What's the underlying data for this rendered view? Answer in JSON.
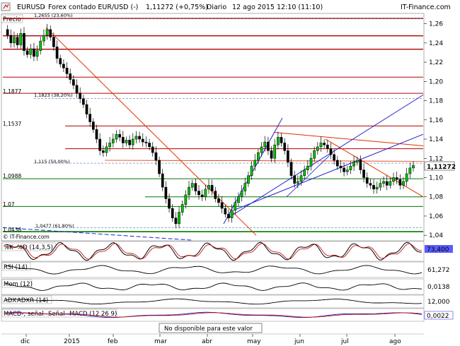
{
  "header": {
    "symbol": "EURUSD",
    "instrument": "Forex contado EUR/USD (-)",
    "last_change": "1,11272 (+0,75%)",
    "timeframe": "Diario",
    "datetime": "12 ago 2015 12:10 (11:10)",
    "source": "IT-Finance.com"
  },
  "main_panel": {
    "label": "Precio",
    "current_price_label": "1,11272",
    "levels_left": [
      "1,1877",
      "1,1537",
      "1,0988",
      "1,07",
      "1,0438"
    ],
    "fib_labels": [
      "1,2655 (23,60%)",
      "1,1823 (38,20%)",
      "1,115 (50,00%)",
      "1,0477 (61,80%)"
    ],
    "watermark": "© IT-Finance.com"
  },
  "indicators": {
    "stoch": {
      "name": "%K",
      "label": "%D (14,3,5)",
      "value": "73,400",
      "value_bg": "#5b5bff"
    },
    "rsi": {
      "label": "RSI (14)",
      "value": "61,272"
    },
    "mom": {
      "label": "Mom (12)",
      "value": "0,0138"
    },
    "adx": {
      "name": "ADX",
      "label": "ADXR (14)",
      "value": "12,000"
    },
    "macd": {
      "name": "MACD-, señal",
      "signal": "Señal",
      "label": "MACD (12 26 9)",
      "value": "0,0022"
    }
  },
  "status_message": "No disponible para este valor",
  "chart_data": {
    "type": "candlestick",
    "title": "EURUSD - Forex contado EUR/USD (-)",
    "x_ticks": [
      "dic",
      "2015",
      "feb",
      "mar",
      "abr",
      "may",
      "jun",
      "jul",
      "ago"
    ],
    "y_ticks": [
      1.26,
      1.24,
      1.22,
      1.2,
      1.18,
      1.16,
      1.14,
      1.12,
      1.1,
      1.08,
      1.06,
      1.04
    ],
    "ylim": [
      1.035,
      1.27
    ],
    "last_price": 1.11272,
    "horizontal_levels_red": [
      1.2655,
      1.2475,
      1.2335,
      1.2045,
      1.1877,
      1.1537,
      1.13
    ],
    "horizontal_levels_green": [
      1.0988,
      1.08,
      1.07,
      1.0438
    ],
    "fibonacci": [
      {
        "label": "23,60%",
        "value": 1.2655
      },
      {
        "label": "38,20%",
        "value": 1.1823
      },
      {
        "label": "50,00%",
        "value": 1.115
      },
      {
        "label": "61,80%",
        "value": 1.0477
      }
    ],
    "price_path": [
      1.254,
      1.248,
      1.24,
      1.246,
      1.238,
      1.25,
      1.232,
      1.228,
      1.234,
      1.226,
      1.232,
      1.242,
      1.248,
      1.254,
      1.246,
      1.236,
      1.224,
      1.218,
      1.214,
      1.208,
      1.202,
      1.196,
      1.188,
      1.182,
      1.176,
      1.166,
      1.158,
      1.15,
      1.14,
      1.128,
      1.126,
      1.132,
      1.136,
      1.14,
      1.145,
      1.142,
      1.136,
      1.139,
      1.134,
      1.14,
      1.143,
      1.14,
      1.137,
      1.136,
      1.132,
      1.126,
      1.118,
      1.104,
      1.09,
      1.078,
      1.068,
      1.058,
      1.052,
      1.064,
      1.072,
      1.082,
      1.09,
      1.094,
      1.086,
      1.082,
      1.08,
      1.088,
      1.092,
      1.086,
      1.078,
      1.074,
      1.068,
      1.062,
      1.058,
      1.066,
      1.074,
      1.08,
      1.086,
      1.094,
      1.102,
      1.112,
      1.118,
      1.126,
      1.132,
      1.137,
      1.128,
      1.12,
      1.134,
      1.142,
      1.136,
      1.128,
      1.116,
      1.102,
      1.094,
      1.096,
      1.102,
      1.108,
      1.112,
      1.12,
      1.128,
      1.132,
      1.136,
      1.134,
      1.13,
      1.124,
      1.118,
      1.112,
      1.11,
      1.106,
      1.108,
      1.112,
      1.116,
      1.118,
      1.108,
      1.1,
      1.094,
      1.092,
      1.088,
      1.09,
      1.094,
      1.096,
      1.092,
      1.096,
      1.1,
      1.098,
      1.092,
      1.096,
      1.104,
      1.11,
      1.11272
    ]
  }
}
